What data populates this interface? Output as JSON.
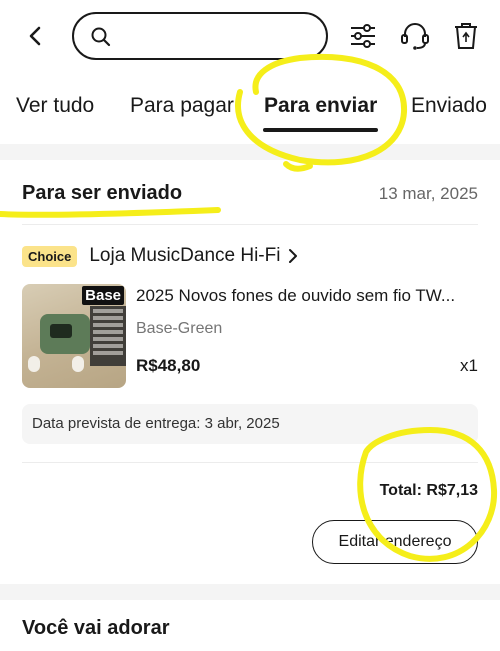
{
  "header": {
    "back_icon": "chevron-left-icon",
    "search": {
      "value": "",
      "placeholder": ""
    },
    "icons": [
      "filter-sliders-icon",
      "headset-icon",
      "trash-icon"
    ]
  },
  "tabs": [
    {
      "label": "Ver tudo",
      "active": false
    },
    {
      "label": "Para pagar",
      "active": false
    },
    {
      "label": "Para enviar",
      "active": true
    },
    {
      "label": "Enviado",
      "active": false
    }
  ],
  "order": {
    "status_title": "Para ser enviado",
    "date": "13 mar, 2025",
    "badge": "Choice",
    "store_name": "Loja MusicDance Hi-Fi",
    "product": {
      "thumb_label": "Base",
      "title": "2025 Novos fones de ouvido sem fio TW...",
      "variant": "Base-Green",
      "price": "R$48,80",
      "quantity": "x1"
    },
    "delivery": "Data prevista de entrega: 3 abr, 2025",
    "total": "Total: R$7,13",
    "edit_label": "Editar endereço"
  },
  "recommendations": {
    "title": "Você vai adorar"
  },
  "colors": {
    "badge": "#fbe38a",
    "annotation": "#f5ee1a",
    "divider_bg": "#f4f4f4"
  }
}
